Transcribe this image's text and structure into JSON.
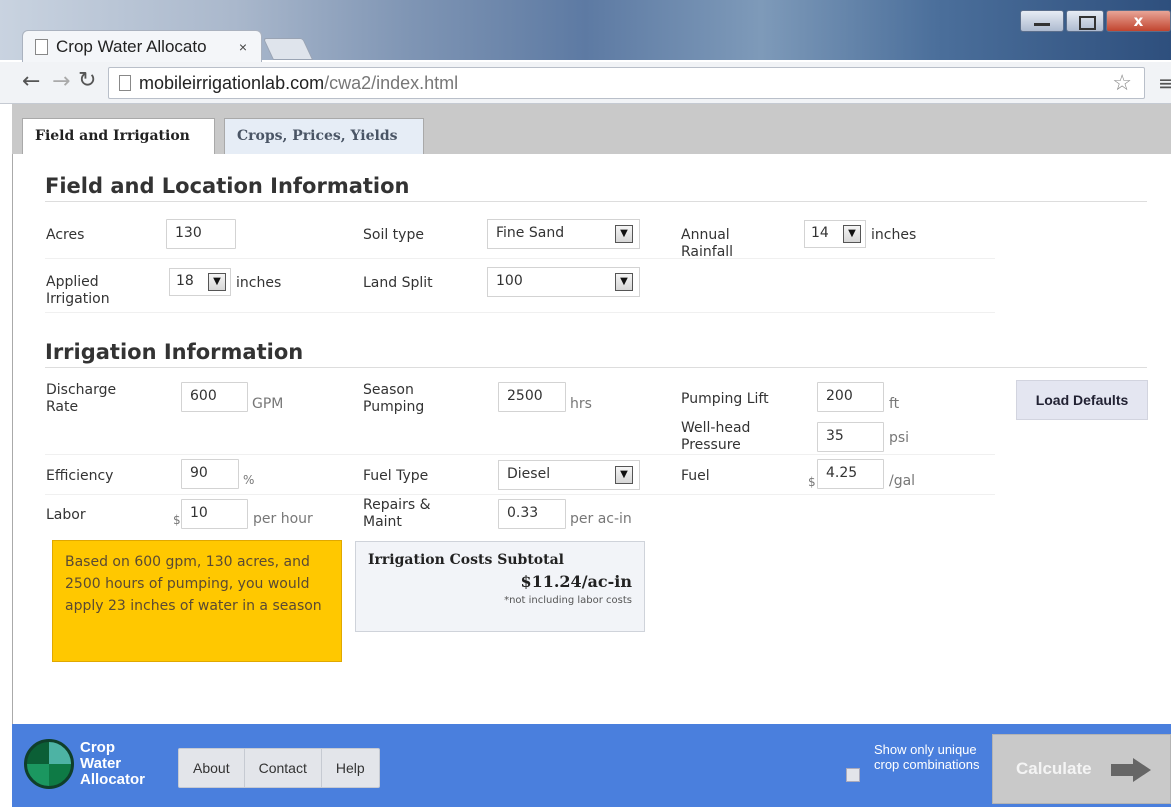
{
  "browser": {
    "tab_title": "Crop Water Allocato",
    "tab_close": "×",
    "url_host": "mobileirrigationlab.com",
    "url_path": "/cwa2/index.html",
    "win_close": "x"
  },
  "app_tabs": [
    {
      "label": "Field and Irrigation"
    },
    {
      "label": "Crops, Prices, Yields"
    }
  ],
  "field_section": {
    "title": "Field and Location Information",
    "acres": {
      "label": "Acres",
      "value": "130"
    },
    "soil_type": {
      "label": "Soil type",
      "value": "Fine Sand"
    },
    "annual_rainfall": {
      "label_line1": "Annual",
      "label_line2": "Rainfall",
      "value": "14",
      "unit": "inches"
    },
    "applied_irrigation": {
      "label_line1": "Applied",
      "label_line2": "Irrigation",
      "value": "18",
      "unit": "inches"
    },
    "land_split": {
      "label": "Land Split",
      "value": "100"
    }
  },
  "irrigation_section": {
    "title": "Irrigation Information",
    "discharge_rate": {
      "label_line1": "Discharge",
      "label_line2": "Rate",
      "value": "600",
      "unit": "GPM"
    },
    "season_pumping": {
      "label_line1": "Season",
      "label_line2": "Pumping",
      "value": "2500",
      "unit": "hrs"
    },
    "pumping_lift": {
      "label": "Pumping Lift",
      "value": "200",
      "unit": "ft"
    },
    "well_head_pressure": {
      "label_line1": "Well-head",
      "label_line2": "Pressure",
      "value": "35",
      "unit": "psi"
    },
    "efficiency": {
      "label": "Efficiency",
      "value": "90",
      "unit": "%"
    },
    "fuel_type": {
      "label": "Fuel Type",
      "value": "Diesel"
    },
    "fuel": {
      "label": "Fuel",
      "currency": "$",
      "value": "4.25",
      "unit": "/gal"
    },
    "labor": {
      "label": "Labor",
      "currency": "$",
      "value": "10",
      "unit": "per hour"
    },
    "repairs": {
      "label_line1": "Repairs &",
      "label_line2": "Maint",
      "value": "0.33",
      "unit": "per ac-in"
    },
    "load_defaults": "Load Defaults"
  },
  "note": "Based on 600 gpm, 130 acres, and 2500 hours of pumping, you would apply 23 inches of water in a season",
  "cost_box": {
    "title": "Irrigation Costs Subtotal",
    "value": "$11.24/ac-in",
    "note": "*not including labor costs"
  },
  "footer": {
    "logo_line1": "Crop",
    "logo_line2": "Water",
    "logo_line3": "Allocator",
    "nav": [
      "About",
      "Contact",
      "Help"
    ],
    "checkbox_label": "Show only unique crop combinations",
    "calculate": "Calculate"
  },
  "colors": {
    "footer_bg": "#4a7fdd",
    "note_bg": "#ffc800",
    "calculate_bg": "#c9c9c9"
  }
}
